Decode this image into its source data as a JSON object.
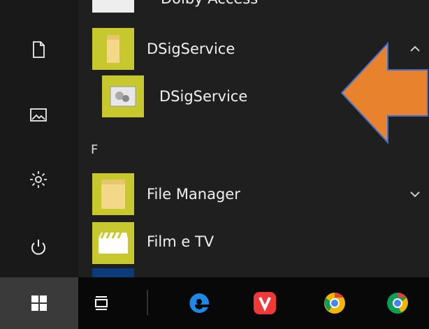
{
  "start_menu": {
    "top_partial_label": "Dolby Access",
    "items": [
      {
        "label": "DSigService",
        "icon": "folder-icon",
        "expanded": true
      },
      {
        "label": "DSigService",
        "icon": "gear-app-icon",
        "child": true
      },
      {
        "label": "File Manager",
        "icon": "folder-icon",
        "expanded": false
      },
      {
        "label": "Film e TV",
        "icon": "clapperboard-icon"
      }
    ],
    "section_letter": "F"
  },
  "left_rail": [
    "document-icon",
    "pictures-icon",
    "settings-icon",
    "power-icon"
  ],
  "taskbar": [
    "windows-start-icon",
    "task-view-icon",
    "edge-icon",
    "vivaldi-icon",
    "chrome-canary-icon",
    "chrome-icon"
  ],
  "colors": {
    "tile": "#c7c72e",
    "arrow": "#e9822d",
    "arrow_border": "#3b6fd1"
  }
}
